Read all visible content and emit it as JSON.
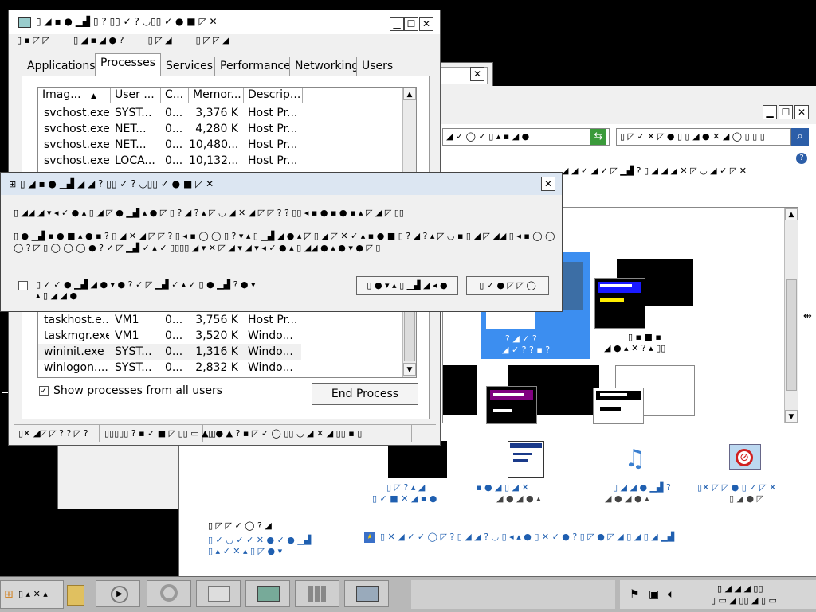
{
  "taskmgr": {
    "title": "▯ ◢ ▪ ● ▁▟ ▯ ? ▯▯ ✓ ? ◡▯▯ ✓ ● ■ ◸ ✕",
    "menu": [
      "▯ ▪ ◸ ◸",
      "▯ ◢ ▪ ◢ ● ?",
      "▯ ◸ ◢",
      "▯ ◸ ◸ ◢"
    ],
    "tabs": [
      "Applications",
      "Processes",
      "Services",
      "Performance",
      "Networking",
      "Users"
    ],
    "columns": [
      "Imag...",
      "User ...",
      "C...",
      "Memor...",
      "Descrip..."
    ],
    "rows_top": [
      [
        "svchost.exe",
        "SYST...",
        "0...",
        "3,376 K",
        "Host Pr..."
      ],
      [
        "svchost.exe",
        "NET...",
        "0...",
        "4,280 K",
        "Host Pr..."
      ],
      [
        "svchost.exe",
        "NET...",
        "0...",
        "10,480...",
        "Host Pr..."
      ],
      [
        "svchost.exe",
        "LOCA...",
        "0...",
        "10,132...",
        "Host Pr..."
      ]
    ],
    "rows_bottom": [
      [
        "taskhost.e...",
        "VM1",
        "0...",
        "3,756 K",
        "Host Pr..."
      ],
      [
        "taskmgr.exe",
        "VM1",
        "0...",
        "3,520 K",
        "Windo..."
      ],
      [
        "wininit.exe",
        "SYST...",
        "0...",
        "1,316 K",
        "Windo..."
      ],
      [
        "winlogon....",
        "SYST...",
        "0...",
        "2,832 K",
        "Windo..."
      ]
    ],
    "show_all_label": "Show processes from all users",
    "end_process_label": "End Process",
    "status": [
      "▯✕ ◢◸ ◸ ? ? ◸ ?",
      "▯▯▯▯▯ ? ▪ ✓ ■ ◸ ▯▯ ▭ ▲ ▯",
      "▯ ● ▲ ? ▪ ◸ ✓ ◯ ▯▯ ◡ ◢ ✕ ◢ ▯▯ ▪ ▯"
    ]
  },
  "dialog": {
    "title": "▯ ◢ ▪ ● ▁▟ ◢ ◢ ? ▯▯ ✓ ? ◡▯▯ ✓ ● ■ ◸ ✕",
    "line1": "▯ ◢◢ ◢ ▾ ◂ ✓ ● ▴ ▯ ◢ ◸ ● ▁▟ ▴ ● ◸ ▯ ? ◢ ? ▴ ◸ ◡ ◢ ✕ ◢ ◸ ◸ ? ? ▯▯ ◂ ▪ ● ▪ ● ▪ ▴ ◸ ◢ ◸ ▯▯",
    "para": "▯ ● ▁▟ ▪ ● ■ ▴ ● ▪ ? ▯ ◢ ✕ ◢ ◸ ◸ ? ▯ ◂ ▪ ◯ ◯ ▯ ? ▾ ▴ ▯ ▁▟ ◢ ● ▴ ◸ ▯ ◢ ◸ ✕ ✓ ▴ ▪ ● ■ ▯ ? ◢ ? ▴ ◸ ◡ ▪ ▯ ◢ ◸ ◢◢ ▯ ◂ ▪ ◯ ◯ ◯ ? ◸ ▯ ◯ ◯ ◯ ● ? ✓ ◸ ▁▟ ✓ ▴ ✓ ▯▯▯▯ ◢ ▾ ✕ ◸ ◢ ▾ ◢ ▾ ◂ ✓ ● ▴ ▯ ◢◢ ● ▴ ● ▾ ● ◸ ▯",
    "checkbox_label": "▯ ✓ ✓ ● ▁▟ ◢ ● ▾ ● ? ✓ ◸ ▁▟ ✓ ▴ ✓ ▯ ● ▁▟ ? ● ▾ ▴ ▯ ◢ ◢ ●",
    "ok_label": "▯ ● ▾ ▴ ▯ ▁▟ ◢ ◂ ●",
    "cancel_label": "▯ ✓ ● ◸ ◸ ◯"
  },
  "control_panel": {
    "address_text": "◢ ✓ ◯ ✓ ▯ ▴ ▪ ◢ ●",
    "search_text": "▯ ◸ ✓ ✕ ◸ ● ▯ ▯ ◢ ● ✕ ◢ ◯ ▯ ▯ ▯",
    "heading1": "◢ ◢ ✓ ◢ ✓ ◸ ▁▟ ? ▯ ◢ ◢ ◢ ✕ ◸ ◡ ◢ ✓ ◸ ✕",
    "subheading": "▯ ▪ ◸ ◸ ? ▾ ▯",
    "themes": [
      {
        "label1": "? ◢ ✓ ?",
        "label2": "◢ ✓ ? ? ▪ ?",
        "selected": true,
        "bg": "#3c6ea5"
      },
      {
        "label1": "▯ ▪ ■ ▪",
        "label2": "◢ ● ▴ ✕ ? ▴ ▯▯",
        "selected": false,
        "bg": "#000000"
      }
    ],
    "bottom_icons": [
      {
        "name": "desktop-background-icon",
        "label1": "▯ ◸ ? ▴ ◢",
        "label2": "▯ ✓ ■ ✕ ◢ ▪ ●"
      },
      {
        "name": "window-color-icon",
        "label1": "▪ ● ◢ ▯ ◢ ✕",
        "label2": "◢ ● ◢ ● ▴"
      },
      {
        "name": "sounds-icon",
        "label1": "▯ ◢ ◢ ● ▁▟ ?",
        "label2": "◢ ● ◢ ● ▴"
      },
      {
        "name": "screen-saver-icon",
        "label1": "▯✕ ◸ ◸ ● ▯ ✓ ◸ ✕",
        "label2": "▯ ◢ ● ◸"
      }
    ],
    "see_also": "▯ ◸ ◸ ✓ ◯ ? ◢",
    "see_also_link": "▯ ✓ ◡ ✓ ✓ ✕ ● ✓ ● ▁▟",
    "see_also_link2": "▯ ▴ ✓ ✕ ▴ ▯ ◸ ● ▾",
    "footer_link": "▯ ✕ ◢ ✓ ✓ ◯ ◸ ? ▯ ◢ ◢ ? ◡ ▯ ◂ ▴ ● ▯ ✕ ✓ ● ? ▯ ◸ ● ◸ ◢ ▯ ◢ ▯ ◢ ▁▟"
  },
  "taskbar": {
    "start_label": "▯ ▴ ✕ ▴",
    "clock_line1": "▯ ◢ ◢ ◢ ▯▯",
    "clock_line2": "▯ ▭ ◢ ▯▯ ◢ ▯ ▭"
  }
}
